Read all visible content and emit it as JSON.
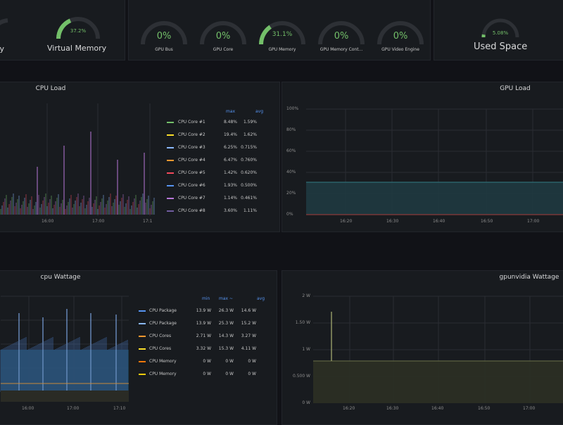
{
  "top": {
    "partial_label": "ry",
    "virtual_memory": {
      "value": "37.2%",
      "label": "Virtual Memory",
      "fraction": 0.372
    },
    "gpu_gauges": [
      {
        "value": "0%",
        "label": "GPU Bus",
        "fraction": 0
      },
      {
        "value": "0%",
        "label": "GPU Core",
        "fraction": 0
      },
      {
        "value": "31.1%",
        "label": "GPU Memory",
        "fraction": 0.311
      },
      {
        "value": "0%",
        "label": "GPU Memory Cont...",
        "fraction": 0
      },
      {
        "value": "0%",
        "label": "GPU Video Engine",
        "fraction": 0
      }
    ],
    "used_space": {
      "value": "5.08%",
      "label": "Used Space",
      "fraction": 0.0508
    }
  },
  "cpu_load": {
    "title": "CPU Load",
    "headers": {
      "max": "max",
      "avg": "avg"
    },
    "x_ticks": [
      "16:00",
      "17:00",
      "17:1"
    ],
    "rows": [
      {
        "name": "CPU Core #1",
        "max": "8.48%",
        "avg": "1.59%",
        "color": "#73bf69"
      },
      {
        "name": "CPU Core #2",
        "max": "19.4%",
        "avg": "1.62%",
        "color": "#fade2a"
      },
      {
        "name": "CPU Core #3",
        "max": "6.25%",
        "avg": "0.715%",
        "color": "#8ab8ff"
      },
      {
        "name": "CPU Core #4",
        "max": "6.47%",
        "avg": "0.760%",
        "color": "#ff9830"
      },
      {
        "name": "CPU Core #5",
        "max": "1.42%",
        "avg": "0.620%",
        "color": "#f2495c"
      },
      {
        "name": "CPU Core #6",
        "max": "1.93%",
        "avg": "0.500%",
        "color": "#5794f2"
      },
      {
        "name": "CPU Core #7",
        "max": "1.14%",
        "avg": "0.461%",
        "color": "#b877d9"
      },
      {
        "name": "CPU Core #8",
        "max": "3.60%",
        "avg": "1.11%",
        "color": "#705da0"
      }
    ]
  },
  "gpu_load": {
    "title": "GPU Load",
    "y_ticks": [
      "100%",
      "80%",
      "60%",
      "40%",
      "20%",
      "0%"
    ],
    "x_ticks": [
      "16:20",
      "16:30",
      "16:40",
      "16:50",
      "17:00"
    ]
  },
  "cpu_wattage": {
    "title": "cpu Wattage",
    "headers": {
      "min": "min",
      "max": "max ~",
      "avg": "avg"
    },
    "x_ticks": [
      "16:00",
      "17:00",
      "17:10"
    ],
    "rows": [
      {
        "name": "CPU Package",
        "min": "13.9 W",
        "max": "26.3 W",
        "avg": "14.6 W",
        "color": "#5794f2"
      },
      {
        "name": "CPU Package",
        "min": "13.9 W",
        "max": "25.3 W",
        "avg": "15.2 W",
        "color": "#8ab8ff"
      },
      {
        "name": "CPU Cores",
        "min": "2.71 W",
        "max": "14.3 W",
        "avg": "3.27 W",
        "color": "#ff9830"
      },
      {
        "name": "CPU Cores",
        "min": "3.32 W",
        "max": "15.3 W",
        "avg": "4.11 W",
        "color": "#fade2a"
      },
      {
        "name": "CPU Memory",
        "min": "0 W",
        "max": "0 W",
        "avg": "0 W",
        "color": "#ff780a"
      },
      {
        "name": "CPU Memory",
        "min": "0 W",
        "max": "0 W",
        "avg": "0 W",
        "color": "#f2cc0c"
      }
    ]
  },
  "gpu_wattage": {
    "title": "gpunvidia Wattage",
    "y_ticks": [
      "2 W",
      "1.50 W",
      "1 W",
      "0.500 W",
      "0 W"
    ],
    "x_ticks": [
      "16:20",
      "16:30",
      "16:40",
      "16:50",
      "17:00"
    ]
  },
  "colors": {
    "gauge_green": "#73bf69",
    "gauge_track": "#2d3035"
  }
}
